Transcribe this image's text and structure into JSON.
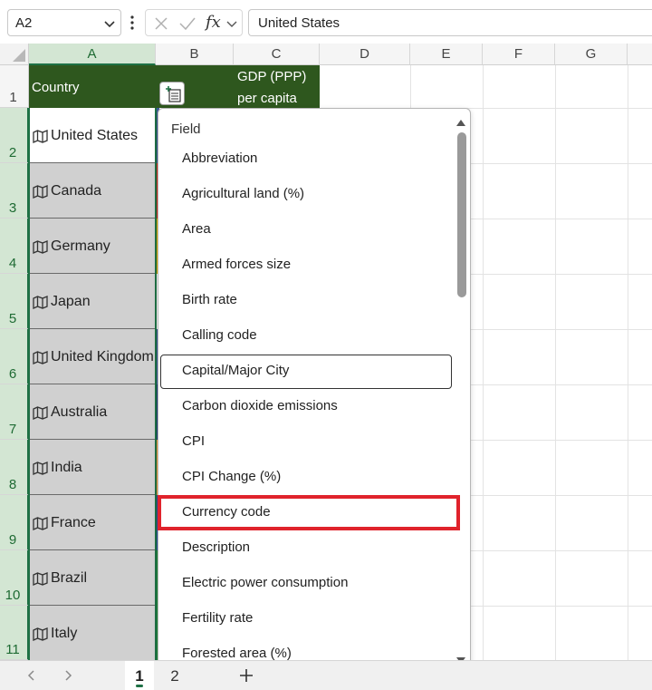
{
  "formula_bar": {
    "name_box": "A2",
    "fx_label": "fx",
    "formula_value": "United States"
  },
  "columns": [
    "A",
    "B",
    "C",
    "D",
    "E",
    "F",
    "G"
  ],
  "rows": [
    "1",
    "2",
    "3",
    "4",
    "5",
    "6",
    "7",
    "8",
    "9",
    "10",
    "11"
  ],
  "header_row": {
    "country": "Country",
    "gdp_line1": "GDP (PPP)",
    "gdp_line2": "per capita"
  },
  "countries": [
    "United States",
    "Canada",
    "Germany",
    "Japan",
    "United Kingdom",
    "Australia",
    "India",
    "France",
    "Brazil",
    "Italy"
  ],
  "dropdown": {
    "heading": "Field",
    "items": [
      "Abbreviation",
      "Agricultural land (%)",
      "Area",
      "Armed forces size",
      "Birth rate",
      "Calling code",
      "Capital/Major City",
      "Carbon dioxide emissions",
      "CPI",
      "CPI Change (%)",
      "Currency code",
      "Description",
      "Electric power consumption",
      "Fertility rate",
      "Forested area (%)"
    ],
    "focused_item": "Capital/Major City",
    "highlighted_item": "Currency code"
  },
  "sheet_tabs": [
    "1",
    "2"
  ],
  "active_tab": "1",
  "colors": {
    "header_fill": "#2e571e",
    "selection_green": "#1e7145",
    "highlight_red": "#e0232c"
  },
  "icons": [
    "chevron-down-icon",
    "more-vertical-icon",
    "cancel-icon",
    "check-icon",
    "function-icon",
    "map-icon",
    "insert-data-icon",
    "chevron-left-icon",
    "chevron-right-icon",
    "plus-icon",
    "scroll-up-icon",
    "scroll-down-icon"
  ]
}
